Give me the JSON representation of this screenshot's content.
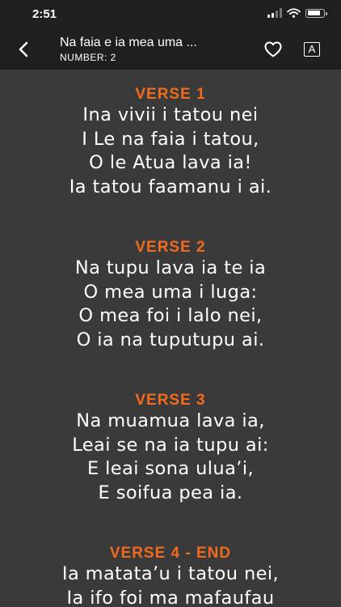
{
  "status": {
    "time": "2:51"
  },
  "nav": {
    "title": "Na faia e ia mea uma ...",
    "subtitle": "NUMBER: 2",
    "font_button_label": "A"
  },
  "verses": [
    {
      "heading": "VERSE 1",
      "lines": [
        "Ina vivii i tatou nei",
        "I Le na faia i tatou,",
        "O le Atua lava ia!",
        "Ia tatou faamanu i ai."
      ]
    },
    {
      "heading": "VERSE 2",
      "lines": [
        "Na tupu lava ia te ia",
        "O mea uma i luga:",
        "O mea foi i lalo nei,",
        "O ia na tuputupu ai."
      ]
    },
    {
      "heading": "VERSE 3",
      "lines": [
        "Na muamua lava ia,",
        "Leai se na ia tupu ai:",
        "E leai sona ulua’i,",
        "E soifua pea ia."
      ]
    },
    {
      "heading": "VERSE 4 - END",
      "lines": [
        "Ia matata’u i tatou nei,",
        "Ia ifo foi ma mafaufau"
      ]
    }
  ],
  "colors": {
    "accent": "#f26b1d",
    "background": "#3a3a3a",
    "bar": "#1f1f1f"
  },
  "icons": {
    "back": "chevron-left-icon",
    "favorite": "heart-icon",
    "font": "font-size-icon"
  }
}
